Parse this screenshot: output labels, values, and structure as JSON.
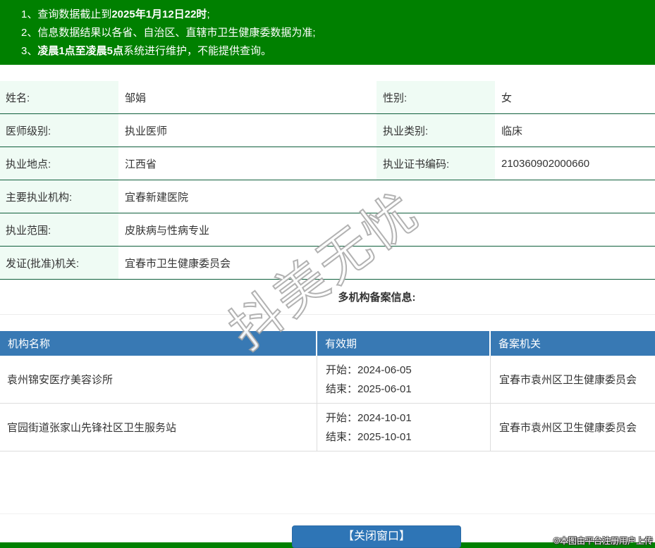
{
  "banner": {
    "notes": [
      {
        "pre": "1、查询数据截止到",
        "bold": "2025年1月12日22时",
        "post": ";"
      },
      {
        "pre": "2、信息数据结果以各省、自治区、直辖市卫生健康委数据为准;",
        "bold": "",
        "post": ""
      },
      {
        "pre": "3、",
        "bold": "凌晨1点至凌晨5点",
        "post": "系统进行维护，不能提供查询。"
      }
    ]
  },
  "info": {
    "rows": [
      {
        "label": "姓名:",
        "value": "邹娟",
        "label2": "性别:",
        "value2": "女"
      },
      {
        "label": "医师级别:",
        "value": "执业医师",
        "label2": "执业类别:",
        "value2": "临床"
      },
      {
        "label": "执业地点:",
        "value": "江西省",
        "label2": "执业证书编码:",
        "value2": "210360902000660"
      },
      {
        "label": "主要执业机构:",
        "value": "宜春新建医院"
      },
      {
        "label": "执业范围:",
        "value": "皮肤病与性病专业"
      },
      {
        "label": "发证(批准)机关:",
        "value": "宜春市卫生健康委员会"
      }
    ]
  },
  "filing": {
    "title": "多机构备案信息:",
    "headers": [
      "机构名称",
      "有效期",
      "备案机关"
    ],
    "rows": [
      {
        "org": "袁州锦安医疗美容诊所",
        "start": "开始：2024-06-05",
        "end": "结束：2025-06-01",
        "authority": "宜春市袁州区卫生健康委员会"
      },
      {
        "org": "官园街道张家山先锋社区卫生服务站",
        "start": "开始：2024-10-01",
        "end": "结束：2025-10-01",
        "authority": "宜春市袁州区卫生健康委员会"
      }
    ]
  },
  "footer": {
    "close_button": "【关闭窗口】",
    "copyright": "©本图由平台注册用户上传"
  },
  "watermark": {
    "text": "抖美无忧"
  },
  "colors": {
    "banner_green": "#008000",
    "table_header_blue": "#3879b4",
    "button_blue": "#2e75b6",
    "label_cell_bg": "#effbf4",
    "row_border_green": "#0f5f3c"
  }
}
